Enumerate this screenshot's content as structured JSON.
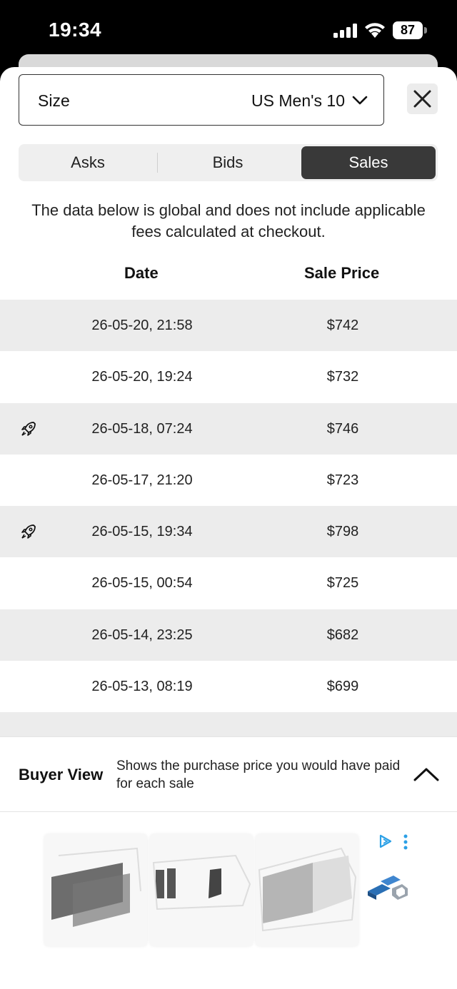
{
  "status_bar": {
    "time": "19:34",
    "battery": "87"
  },
  "size_select": {
    "label": "Size",
    "value": "US Men's 10"
  },
  "tabs": [
    {
      "label": "Asks",
      "active": false
    },
    {
      "label": "Bids",
      "active": false
    },
    {
      "label": "Sales",
      "active": true
    }
  ],
  "notice": "The data below is global and does not include applicable fees calculated at checkout.",
  "columns": {
    "date": "Date",
    "price": "Sale Price"
  },
  "sales": [
    {
      "date": "26-05-20, 21:58",
      "price": "$742",
      "rocket": false
    },
    {
      "date": "26-05-20, 19:24",
      "price": "$732",
      "rocket": false
    },
    {
      "date": "26-05-18, 07:24",
      "price": "$746",
      "rocket": true
    },
    {
      "date": "26-05-17, 21:20",
      "price": "$723",
      "rocket": false
    },
    {
      "date": "26-05-15, 19:34",
      "price": "$798",
      "rocket": true
    },
    {
      "date": "26-05-15, 00:54",
      "price": "$725",
      "rocket": false
    },
    {
      "date": "26-05-14, 23:25",
      "price": "$682",
      "rocket": false
    },
    {
      "date": "26-05-13, 08:19",
      "price": "$699",
      "rocket": false
    }
  ],
  "buyer_view": {
    "title": "Buyer View",
    "description": "Shows the purchase price you would have paid for each sale"
  },
  "colors": {
    "active_tab": "#393939",
    "shaded_row": "#ececec",
    "ad_choice": "#2ba0e6"
  },
  "icons": {
    "rocket": "rocket-icon",
    "close": "close-icon",
    "chevron": "chevron-down-icon"
  }
}
